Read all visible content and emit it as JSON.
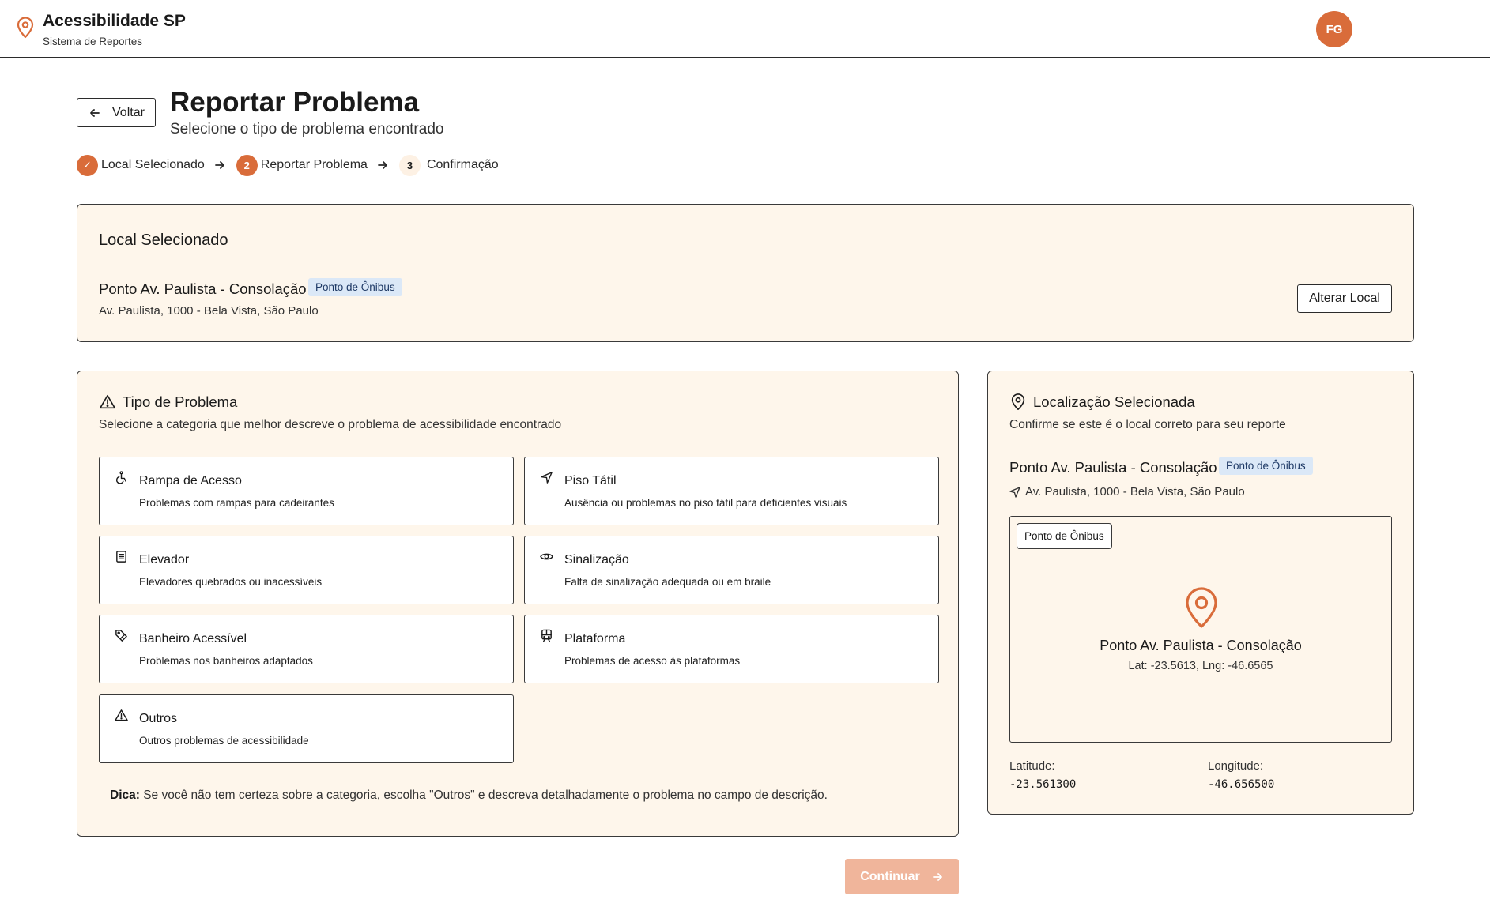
{
  "header": {
    "app_title": "Acessibilidade SP",
    "app_subtitle": "Sistema de Reportes",
    "avatar_initials": "FG",
    "brand_icon": "map-pin-icon"
  },
  "page": {
    "back_label": "Voltar",
    "title": "Reportar Problema",
    "subtitle": "Selecione o tipo de problema encontrado"
  },
  "stepper": {
    "steps": [
      {
        "label": "Local Selecionado",
        "marker": "✓",
        "status": "done"
      },
      {
        "label": "Reportar Problema",
        "marker": "2",
        "status": "active"
      },
      {
        "label": "Confirmação",
        "marker": "3",
        "status": "todo"
      }
    ]
  },
  "local_panel": {
    "heading": "Local Selecionado",
    "name": "Ponto Av. Paulista - Consolação",
    "badge": "Ponto de Ônibus",
    "address": "Av. Paulista, 1000 - Bela Vista, São Paulo",
    "change_label": "Alterar Local"
  },
  "problem_panel": {
    "heading": "Tipo de Problema",
    "subtitle": "Selecione a categoria que melhor descreve o problema de acessibilidade encontrado",
    "categories": [
      {
        "title": "Rampa de Acesso",
        "desc": "Problemas com rampas para cadeirantes",
        "icon": "wheelchair-icon"
      },
      {
        "title": "Piso Tátil",
        "desc": "Ausência ou problemas no piso tátil para deficientes visuais",
        "icon": "navigation-icon"
      },
      {
        "title": "Elevador",
        "desc": "Elevadores quebrados ou inacessíveis",
        "icon": "elevator-icon"
      },
      {
        "title": "Sinalização",
        "desc": "Falta de sinalização adequada ou em braile",
        "icon": "eye-icon"
      },
      {
        "title": "Banheiro Acessível",
        "desc": "Problemas nos banheiros adaptados",
        "icon": "tag-icon"
      },
      {
        "title": "Plataforma",
        "desc": "Problemas de acesso às plataformas",
        "icon": "train-icon"
      },
      {
        "title": "Outros",
        "desc": "Outros problemas de acessibilidade",
        "icon": "warning-icon"
      }
    ],
    "tip_label": "Dica:",
    "tip_text": " Se você não tem certeza sobre a categoria, escolha \"Outros\" e descreva detalhadamente o problema no campo de descrição."
  },
  "map_panel": {
    "heading": "Localização Selecionada",
    "subtitle": "Confirme se este é o local correto para seu reporte",
    "name": "Ponto Av. Paulista - Consolação",
    "badge": "Ponto de Ônibus",
    "address": "Av. Paulista, 1000 - Bela Vista, São Paulo",
    "map_tag": "Ponto de Ônibus",
    "map_name": "Ponto Av. Paulista - Consolação",
    "map_coords": "Lat: -23.5613, Lng: -46.6565",
    "lat_label": "Latitude:",
    "lat_value": "-23.561300",
    "lng_label": "Longitude:",
    "lng_value": "-46.656500"
  },
  "footer": {
    "continue_label": "Continuar"
  },
  "colors": {
    "accent": "#d96c3a",
    "panel_bg": "#fef6eb",
    "badge_bg": "#dbe8f7",
    "continue_disabled": "#f0b59b"
  }
}
